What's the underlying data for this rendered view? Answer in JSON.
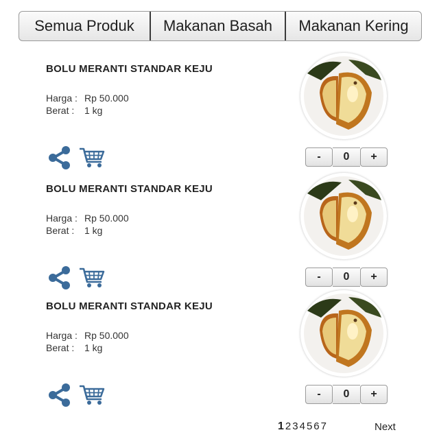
{
  "tabs": [
    {
      "label": "Semua Produk"
    },
    {
      "label": "Makanan Basah"
    },
    {
      "label": "Makanan Kering"
    }
  ],
  "products": [
    {
      "title": "BOLU MERANTI STANDAR KEJU",
      "price_label": "Harga :",
      "price": "Rp 50.000",
      "weight_label": "Berat  :",
      "weight": "1 kg",
      "qty_minus": "-",
      "qty": "0",
      "qty_plus": "+"
    },
    {
      "title": "BOLU MERANTI STANDAR KEJU",
      "price_label": "Harga :",
      "price": "Rp 50.000",
      "weight_label": "Berat  :",
      "weight": "1 kg",
      "qty_minus": "-",
      "qty": "0",
      "qty_plus": "+"
    },
    {
      "title": "BOLU MERANTI STANDAR KEJU",
      "price_label": "Harga :",
      "price": "Rp 50.000",
      "weight_label": "Berat  :",
      "weight": "1 kg",
      "qty_minus": "-",
      "qty": "0",
      "qty_plus": "+"
    }
  ],
  "icons": {
    "share": "share-icon",
    "cart": "cart-icon"
  },
  "colors": {
    "icon_blue": "#3b6b9a"
  },
  "pagination": {
    "pages": [
      "1",
      "2",
      "3",
      "4",
      "5",
      "6",
      "7"
    ],
    "current": "1",
    "next_label": "Next"
  }
}
